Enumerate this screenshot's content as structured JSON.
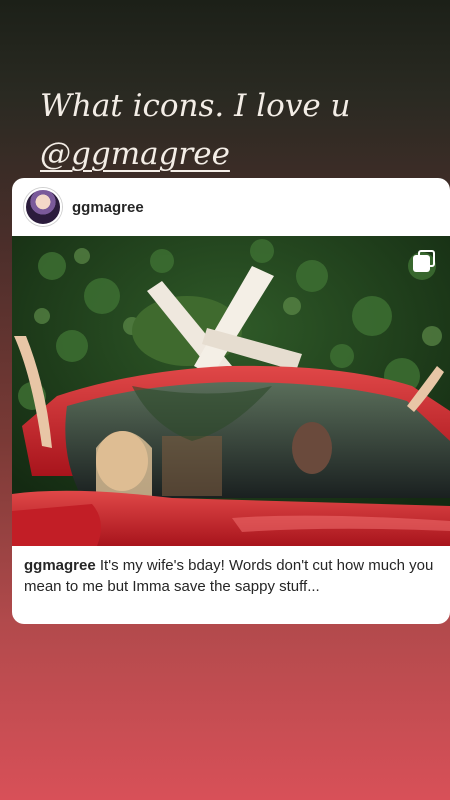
{
  "story": {
    "caption_line1": "What icons. I love u",
    "caption_mention": "@ggmagree"
  },
  "post": {
    "username": "ggmagree",
    "caption_username": "ggmagree",
    "caption_text": " It's my wife's bday! Words don't cut how much you mean to me but Imma save the sappy stuff...",
    "avatar_icon": "profile-avatar",
    "multi_icon": "carousel-icon"
  }
}
